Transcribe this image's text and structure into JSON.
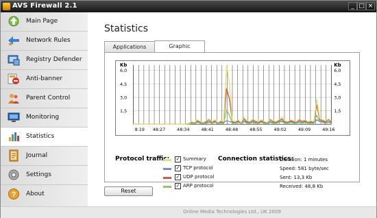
{
  "window": {
    "title": "AVS Firewall 2.1",
    "minimize": "_",
    "maximize": "□",
    "close": "×"
  },
  "sidebar": {
    "items": [
      {
        "label": "Main Page",
        "icon": "home-icon"
      },
      {
        "label": "Network Rules",
        "icon": "network-icon"
      },
      {
        "label": "Registry Defender",
        "icon": "registry-icon"
      },
      {
        "label": "Anti-banner",
        "icon": "anti-banner-icon"
      },
      {
        "label": "Parent Control",
        "icon": "parent-control-icon"
      },
      {
        "label": "Monitoring",
        "icon": "monitor-icon"
      },
      {
        "label": "Statistics",
        "icon": "statistics-icon",
        "active": true
      },
      {
        "label": "Journal",
        "icon": "journal-icon"
      },
      {
        "label": "Settings",
        "icon": "settings-icon"
      },
      {
        "label": "About",
        "icon": "about-icon"
      }
    ]
  },
  "main": {
    "title": "Statistics",
    "tabs": [
      {
        "label": "Applications"
      },
      {
        "label": "Graphic",
        "active": true
      }
    ],
    "reset_label": "Reset",
    "footer": "Online Media Technologies Ltd., UK 2009"
  },
  "legend": {
    "title": "Protocol traffic:",
    "items": [
      {
        "label": "Summary",
        "color": "#e6e07a",
        "checked": true
      },
      {
        "label": "TCP protocol",
        "color": "#6f8fc8",
        "checked": true
      },
      {
        "label": "UDP protocol",
        "color": "#c0604a",
        "checked": true
      },
      {
        "label": "ARP protocol",
        "color": "#8fc86a",
        "checked": true
      }
    ]
  },
  "connection": {
    "title": "Connection statistics:",
    "rows": [
      {
        "text": "Duration:   1 minutes"
      },
      {
        "text": "Speed:   581 byte/sec"
      },
      {
        "text": "Sent:   13,3 Kb"
      },
      {
        "text": "Received:   48,8 Kb"
      }
    ]
  },
  "chart_data": {
    "type": "line",
    "ylabel": "Kb",
    "ylim": [
      0,
      6.6
    ],
    "yticks": [
      "6,0",
      "4,5",
      "3,0",
      "1,5"
    ],
    "x": [
      "8:19",
      "48:27",
      "48:34",
      "48:41",
      "48:48",
      "48:55",
      "49:02",
      "49:09",
      "49:16"
    ],
    "grid": true,
    "series": [
      {
        "name": "Summary",
        "color": "#e6e07a",
        "values": [
          0,
          0,
          0,
          0,
          0,
          0,
          0,
          0,
          0,
          0,
          0,
          0,
          0,
          0,
          0,
          0,
          0,
          0,
          0,
          0.1,
          0.3,
          0.2,
          0.5,
          0.3,
          0.2,
          0.4,
          0.6,
          0.3,
          0.5,
          0.2,
          0.4,
          0.3,
          6.6,
          4.5,
          0.4,
          0.3,
          0.5,
          0.2,
          0.8,
          0.4,
          0.3,
          0.6,
          0.4,
          0.3,
          0.5,
          0.3,
          0.2,
          0.6,
          0.4,
          0.3,
          0.5,
          0.8,
          0.4,
          0.3,
          0.5,
          0.4,
          0.3,
          0.6,
          0.4,
          0.5,
          0.3,
          0.4,
          0.3,
          2.8,
          0.7,
          0.5,
          0.4,
          0.6,
          0.4
        ]
      },
      {
        "name": "TCP protocol",
        "color": "#6f8fc8",
        "values": [
          0,
          0,
          0,
          0,
          0,
          0,
          0,
          0,
          0,
          0,
          0,
          0,
          0,
          0,
          0,
          0,
          0,
          0,
          0,
          0.1,
          0.2,
          0.1,
          0.3,
          0.2,
          0.1,
          0.2,
          0.3,
          0.2,
          0.3,
          0.1,
          0.2,
          0.2,
          0.4,
          0.3,
          0.2,
          0.2,
          0.3,
          0.1,
          0.4,
          0.2,
          0.2,
          0.3,
          0.2,
          0.2,
          0.3,
          0.2,
          0.1,
          0.3,
          0.2,
          0.2,
          0.3,
          0.4,
          0.2,
          0.2,
          0.3,
          0.2,
          0.2,
          0.3,
          0.2,
          0.3,
          0.2,
          0.2,
          0.2,
          0.5,
          0.3,
          0.3,
          0.2,
          0.3,
          0.2
        ]
      },
      {
        "name": "UDP protocol",
        "color": "#c0604a",
        "values": [
          0,
          0,
          0,
          0,
          0,
          0,
          0,
          0,
          0,
          0,
          0,
          0,
          0,
          0,
          0,
          0,
          0,
          0,
          0,
          0.1,
          0.2,
          0.2,
          0.4,
          0.2,
          0.2,
          0.3,
          0.5,
          0.2,
          0.4,
          0.2,
          0.3,
          0.2,
          4.0,
          2.8,
          0.3,
          0.2,
          0.4,
          0.2,
          0.6,
          0.3,
          0.2,
          0.5,
          0.3,
          0.2,
          0.4,
          0.2,
          0.2,
          0.5,
          0.3,
          0.2,
          0.4,
          0.6,
          0.3,
          0.2,
          0.4,
          0.3,
          0.2,
          0.5,
          0.3,
          0.4,
          0.2,
          0.3,
          0.2,
          2.2,
          0.5,
          0.4,
          0.3,
          0.5,
          0.3
        ]
      },
      {
        "name": "ARP protocol",
        "color": "#8fc86a",
        "values": [
          0,
          0,
          0,
          0,
          0,
          0,
          0,
          0,
          0,
          0,
          0,
          0,
          0,
          0,
          0,
          0,
          0,
          0,
          0,
          0.0,
          0.1,
          0.1,
          0.2,
          0.1,
          0.1,
          0.1,
          0.2,
          0.1,
          0.2,
          0.1,
          0.1,
          0.1,
          1.6,
          1.0,
          0.1,
          0.1,
          0.2,
          0.1,
          0.3,
          0.1,
          0.1,
          0.2,
          0.1,
          0.1,
          0.2,
          0.1,
          0.1,
          0.2,
          0.1,
          0.1,
          0.2,
          0.3,
          0.1,
          0.1,
          0.2,
          0.1,
          0.1,
          0.2,
          0.1,
          0.2,
          0.1,
          0.1,
          0.1,
          1.0,
          0.3,
          0.2,
          0.1,
          0.2,
          0.1
        ]
      }
    ]
  }
}
